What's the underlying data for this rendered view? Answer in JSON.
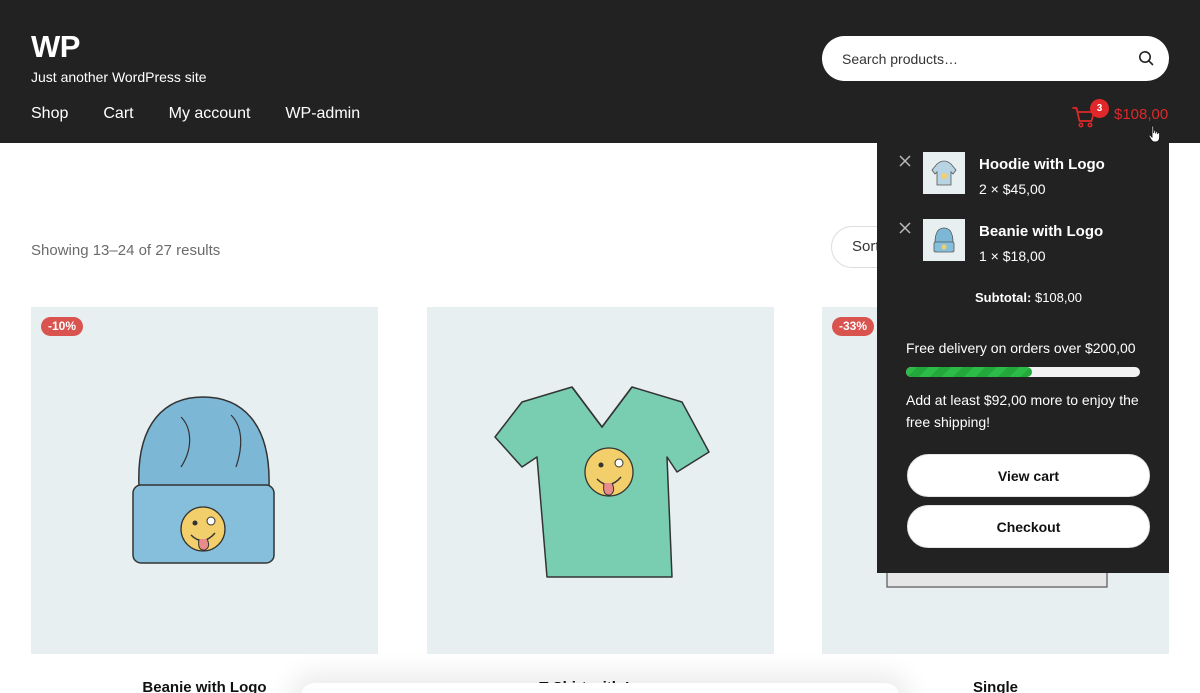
{
  "site": {
    "title": "WP",
    "tagline": "Just another WordPress site"
  },
  "nav": [
    {
      "label": "Shop"
    },
    {
      "label": "Cart"
    },
    {
      "label": "My account"
    },
    {
      "label": "WP-admin"
    }
  ],
  "search": {
    "placeholder": "Search products…"
  },
  "cart": {
    "count": "3",
    "total": "$108,00",
    "accent_color": "#e0282a"
  },
  "content": {
    "result_count": "Showing 13–24 of 27 results",
    "sort_label": "Sort"
  },
  "products": [
    {
      "title": "Beanie with Logo",
      "badge": "-10%"
    },
    {
      "title": "T-Shirt with Logo",
      "badge": ""
    },
    {
      "title": "Single",
      "badge": "-33%"
    }
  ],
  "mini_cart": {
    "items": [
      {
        "name": "Hoodie with Logo",
        "qty": "2 × $45,00"
      },
      {
        "name": "Beanie with Logo",
        "qty": "1 × $18,00"
      }
    ],
    "subtotal_label": "Subtotal:",
    "subtotal_value": "$108,00",
    "free_delivery": "Free delivery on orders over $200,00",
    "progress_fraction": 0.54,
    "add_more": "Add at least $92,00 more to enjoy the free shipping!",
    "view_cart": "View cart",
    "checkout": "Checkout"
  }
}
